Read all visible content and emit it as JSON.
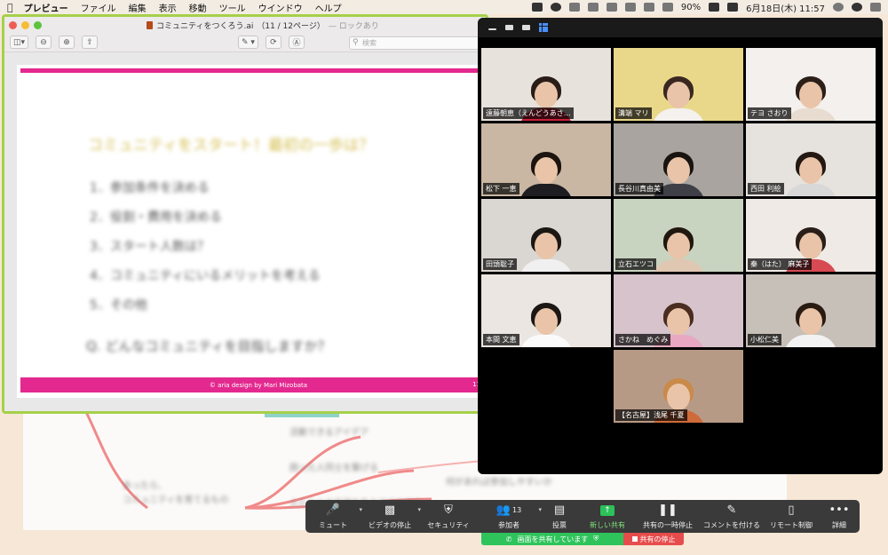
{
  "menubar": {
    "app": "プレビュー",
    "items": [
      "ファイル",
      "編集",
      "表示",
      "移動",
      "ツール",
      "ウインドウ",
      "ヘルプ"
    ],
    "battery": "90%",
    "datetime": "6月18日(木)  11:57"
  },
  "preview": {
    "title": "コミュニティをつくろう.ai",
    "pages": "（11 / 12ページ）",
    "locked": "— ロックあり",
    "search_placeholder": "検索",
    "slide": {
      "title": "コミュニティをスタート！最初の一歩は？",
      "items": [
        "1．参加条件を決める",
        "2．役割・費用を決める",
        "3．スタート人数は？",
        "4．コミュニティにいるメリットを考える",
        "5．その他"
      ],
      "question": "Q. どんなコミュニティを目指しますか？",
      "footer": "© aria design  by Mari Mizobata",
      "page_no": "11"
    }
  },
  "mindmap": {
    "nodes": [
      "活動できるアイデア",
      "困った人同士を繋げる",
      "あったら、",
      "コミュニティを育てるもの",
      "人と人との交流を生み出す仕組み",
      "何があれば参加しやすいか"
    ]
  },
  "participants": [
    {
      "name": "遠藤朝恵（えんどうあさ…",
      "active": true,
      "bg": "#e8e2dc",
      "hair": "#2a1d17",
      "top": "#c9213a"
    },
    {
      "name": "溝端 マリ",
      "active": false,
      "bg": "#e9d88a",
      "hair": "#3a2820",
      "top": "#f4f1ee"
    },
    {
      "name": "テヨ さおり",
      "active": false,
      "bg": "#f3f0ed",
      "hair": "#2b1f18",
      "top": "#e8dcd0"
    },
    {
      "name": "松下 一恵",
      "active": false,
      "bg": "#c9b6a3",
      "hair": "#1b1410",
      "top": "#1d1d22"
    },
    {
      "name": "長谷川真由美",
      "active": false,
      "bg": "#a9a49f",
      "hair": "#1a1411",
      "top": "#3f3f48"
    },
    {
      "name": "西田 利絵",
      "active": false,
      "bg": "#e6e2de",
      "hair": "#241813",
      "top": "#d8d8d8"
    },
    {
      "name": "田頭聡子",
      "active": false,
      "bg": "#dad6d2",
      "hair": "#1c1714",
      "top": "#f0f0f0"
    },
    {
      "name": "立石エツコ",
      "active": false,
      "bg": "#c9d4c0",
      "hair": "#20170f",
      "top": "#e0c7b2"
    },
    {
      "name": "秦（はた） 麻美子",
      "active": false,
      "bg": "#efeae6",
      "hair": "#2a1e18",
      "top": "#d84a52"
    },
    {
      "name": "本間 文恵",
      "active": false,
      "bg": "#ebe6e1",
      "hair": "#1c1714",
      "top": "#fafafa"
    },
    {
      "name": "さかね　めぐみ",
      "active": false,
      "bg": "#d6c3cc",
      "hair": "#4a2c20",
      "top": "#e8a8c2"
    },
    {
      "name": "小松仁美",
      "active": false,
      "bg": "#c7c0b8",
      "hair": "#2a1b12",
      "top": "#f2f2f2"
    },
    {
      "name": "【名古屋】浅尾 千夏",
      "active": false,
      "bg": "#b79a86",
      "hair": "#c98a4a",
      "top": "#cf6a3a"
    }
  ],
  "toolbar": {
    "mute": "ミュート",
    "video": "ビデオの停止",
    "security": "セキュリティ",
    "participants": "参加者",
    "participants_count": "13",
    "poll": "投票",
    "new_share": "新しい共有",
    "pause_share": "共有の一時停止",
    "annotate": "コメントを付ける",
    "remote": "リモート制御",
    "more": "詳細"
  },
  "share_status": {
    "sharing": "画面を共有しています",
    "stop": "共有の停止"
  }
}
